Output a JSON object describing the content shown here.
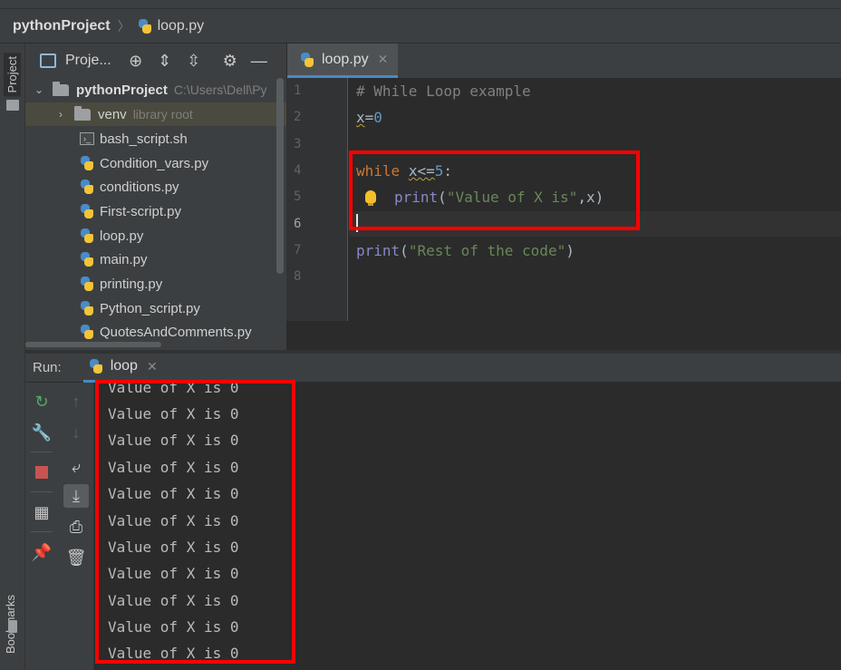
{
  "breadcrumb": {
    "project": "pythonProject",
    "file": "loop.py"
  },
  "sidebar": {
    "project_tab": "Project",
    "bookmarks_tab": "Bookmarks"
  },
  "project_panel": {
    "title": "Proje...",
    "root": {
      "name": "pythonProject",
      "path": "C:\\Users\\Dell\\Py"
    },
    "venv": {
      "name": "venv",
      "hint": "library root"
    },
    "files": [
      "bash_script.sh",
      "Condition_vars.py",
      "conditions.py",
      "First-script.py",
      "loop.py",
      "main.py",
      "printing.py",
      "Python_script.py",
      "QuotesAndComments.py"
    ]
  },
  "editor": {
    "tab_label": "loop.py",
    "line_numbers": [
      "1",
      "2",
      "3",
      "4",
      "5",
      "6",
      "7",
      "8"
    ],
    "current_line": 6,
    "code": {
      "comment": "# While Loop example",
      "assign_var": "x",
      "assign_eq": "=",
      "assign_val": "0",
      "while_kw": "while",
      "while_cond": "x<=",
      "while_num": "5",
      "while_colon": ":",
      "print_fn": "print",
      "print_open": "(",
      "print_str": "\"Value of X is\"",
      "print_args": ",x)",
      "print2_fn": "print",
      "print2_open": "(",
      "print2_str": "\"Rest of the code\"",
      "print2_close": ")"
    }
  },
  "run_panel": {
    "label": "Run:",
    "tab_label": "loop",
    "output": [
      "Value of X is 0",
      "Value of X is 0",
      "Value of X is 0",
      "Value of X is 0",
      "Value of X is 0",
      "Value of X is 0",
      "Value of X is 0",
      "Value of X is 0",
      "Value of X is 0",
      "Value of X is 0",
      "Value of X is 0"
    ]
  },
  "colors": {
    "highlight": "#ff0000",
    "accent": "#4a88c7"
  }
}
